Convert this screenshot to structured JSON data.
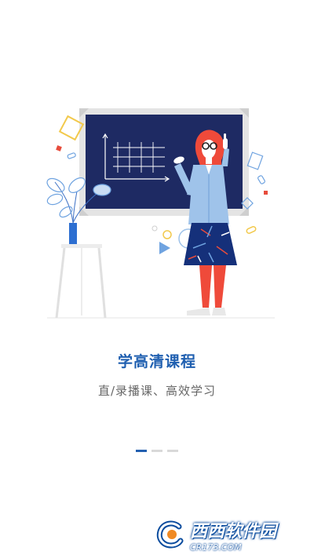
{
  "slide": {
    "title": "学高清课程",
    "subtitle": "直/录播课、高效学习"
  },
  "pager": {
    "count": 3,
    "active_index": 0
  },
  "watermark": {
    "name": "西西软件园",
    "url": "CR173.COM"
  },
  "colors": {
    "accent": "#2360b0",
    "board": "#1e2a63",
    "jacket": "#9fc3ea",
    "skirt": "#15307a",
    "legs": "#ef4a3a",
    "hair": "#ef4a3a"
  }
}
